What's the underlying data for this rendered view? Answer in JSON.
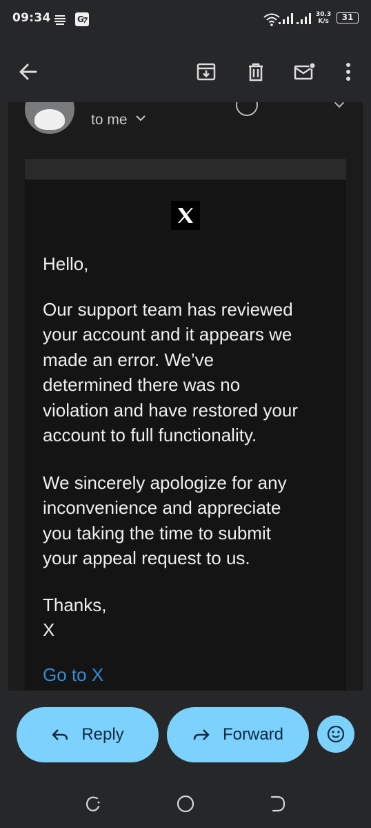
{
  "status_bar": {
    "time": "09:34",
    "net_speed_value": "30.3",
    "net_speed_unit": "K/s",
    "battery_level": "31"
  },
  "toolbar": {
    "back_icon": "arrow-left-icon",
    "archive_icon": "archive-icon",
    "delete_icon": "trash-icon",
    "mark_unread_icon": "mail-unread-icon",
    "more_icon": "more-vert-icon"
  },
  "email": {
    "recipient_label": "to me",
    "brand_logo": "X",
    "greeting": "Hello,",
    "paragraph_1": "Our support team has reviewed\nyour account and it appears we\nmade an error. We’ve\ndetermined there was no\nviolation and have restored your\naccount to full functionality.",
    "paragraph_2": "We sincerely apologize for any\ninconvenience and appreciate\nyou taking the time to submit\nyour appeal request to us.",
    "sign_off": "Thanks,\nX",
    "link_text": "Go to X"
  },
  "actions": {
    "reply_label": "Reply",
    "forward_label": "Forward",
    "emoji_icon": "smiley-icon"
  },
  "colors": {
    "accent": "#7dd1fd",
    "link": "#2f8fd8",
    "background": "#262729",
    "card": "#141414"
  }
}
